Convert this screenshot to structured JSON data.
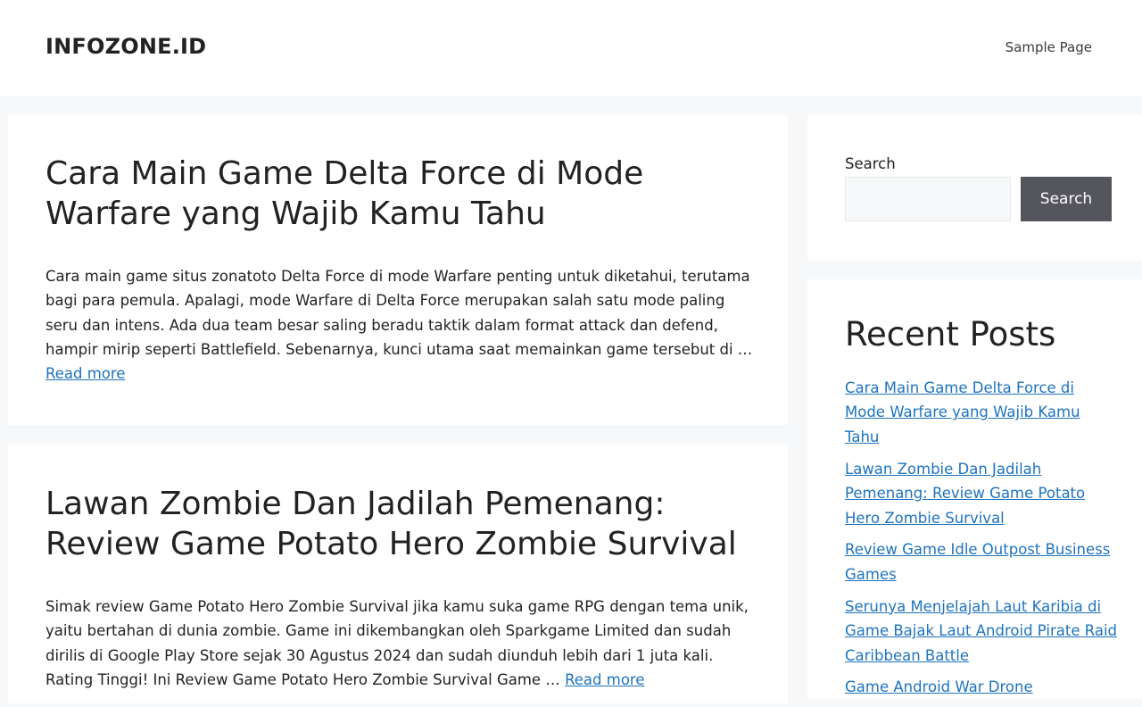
{
  "header": {
    "site_title": "INFOZONE.ID",
    "nav": [
      "Sample Page"
    ]
  },
  "posts": [
    {
      "title": "Cara Main Game Delta Force di Mode Warfare yang Wajib Kamu Tahu",
      "excerpt": "Cara main game situs zonatoto Delta Force di mode Warfare penting untuk diketahui, terutama bagi para pemula. Apalagi, mode Warfare di Delta Force merupakan salah satu mode paling seru dan intens. Ada dua team besar saling beradu taktik dalam format attack dan defend, hampir mirip seperti Battlefield. Sebenarnya, kunci utama saat memainkan game tersebut di … ",
      "read_more": "Read more"
    },
    {
      "title": "Lawan Zombie Dan Jadilah Pemenang: Review Game Potato Hero Zombie Survival",
      "excerpt": "Simak review Game Potato Hero Zombie Survival jika kamu suka game RPG dengan tema unik, yaitu bertahan di dunia zombie. Game ini dikembangkan oleh Sparkgame Limited dan sudah dirilis di Google Play Store sejak 30 Agustus 2024 dan sudah diunduh lebih dari 1 juta kali. Rating Tinggi! Ini Review Game Potato Hero Zombie Survival Game … ",
      "read_more": "Read more"
    }
  ],
  "sidebar": {
    "search": {
      "label": "Search",
      "placeholder": "",
      "button": "Search"
    },
    "recent": {
      "title": "Recent Posts",
      "items": [
        "Cara Main Game Delta Force di Mode Warfare yang Wajib Kamu Tahu",
        "Lawan Zombie Dan Jadilah Pemenang: Review Game Potato Hero Zombie Survival",
        "Review Game Idle Outpost Business Games",
        "Serunya Menjelajah Laut Karibia di Game Bajak Laut Android Pirate Raid Caribbean Battle",
        "Game Android War Drone"
      ]
    }
  },
  "colors": {
    "link": "#1e73be",
    "button_bg": "#55555e",
    "page_bg": "#f7f8f9"
  }
}
